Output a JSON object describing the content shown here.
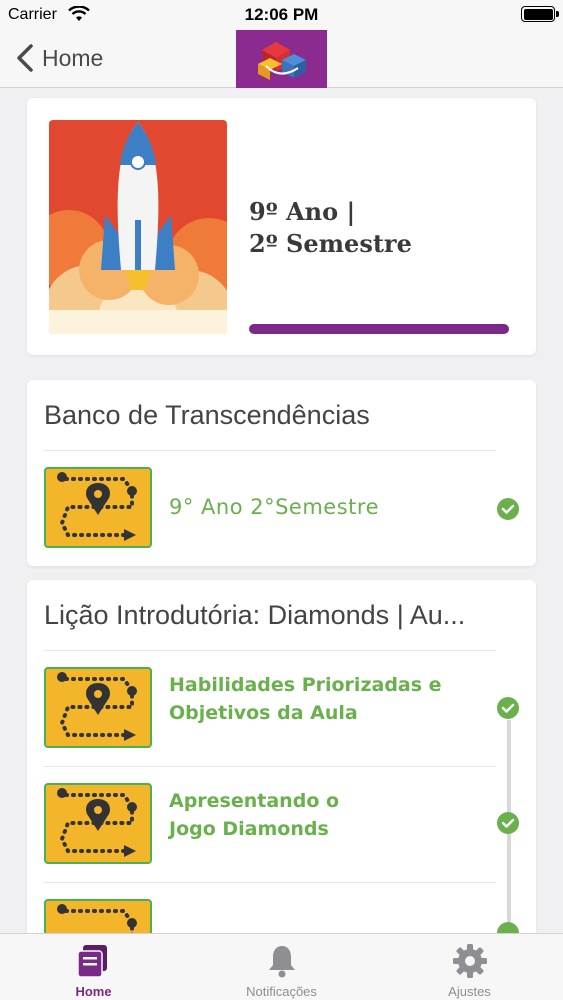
{
  "status_bar": {
    "carrier": "Carrier",
    "time": "12:06 PM"
  },
  "nav": {
    "back_label": "Home"
  },
  "course": {
    "title_line1": "9º Ano |",
    "title_line2": "2º Semestre",
    "progress_pct": 100
  },
  "sections": [
    {
      "title": "Banco de Transcendências",
      "lessons": [
        {
          "label": "9° Ano 2°Semestre",
          "completed": true
        }
      ]
    },
    {
      "title": "Lição Introdutória: Diamonds | Au...",
      "lessons": [
        {
          "label_line1": "Habilidades Priorizadas e",
          "label_line2": "Objetivos da Aula",
          "completed": true
        },
        {
          "label_line1": "Apresentando o",
          "label_line2": "Jogo Diamonds",
          "completed": true
        }
      ]
    }
  ],
  "tab_bar": {
    "tabs": [
      {
        "label": "Home",
        "icon": "cards-icon",
        "active": true
      },
      {
        "label": "Notificações",
        "icon": "bell-icon",
        "active": false
      },
      {
        "label": "Ajustes",
        "icon": "gear-icon",
        "active": false
      }
    ]
  },
  "colors": {
    "brand_purple": "#7a2a86",
    "success_green": "#6ab04c",
    "thumb_orange": "#f3b52a"
  }
}
